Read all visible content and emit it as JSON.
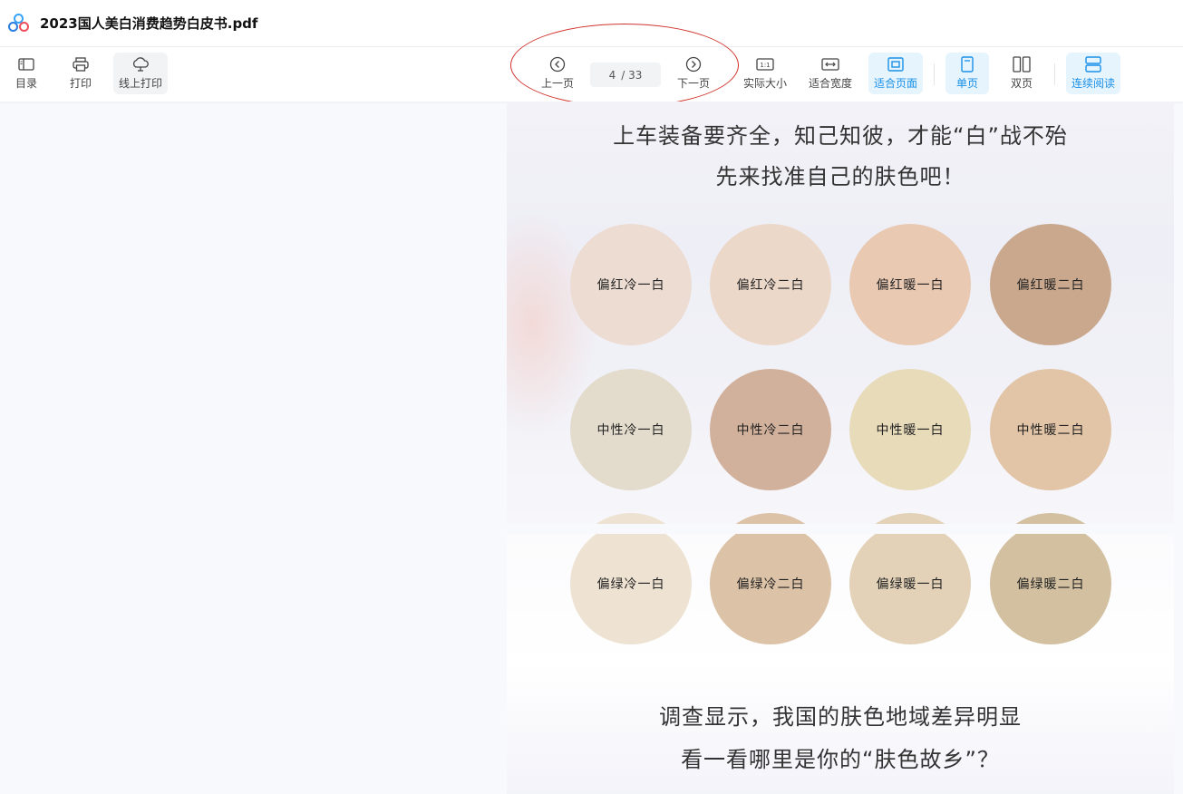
{
  "window": {
    "title": "2023国人美白消费趋势白皮书.pdf"
  },
  "toolbar": {
    "toc_label": "目录",
    "print_label": "打印",
    "online_print_label": "线上打印",
    "prev_label": "上一页",
    "next_label": "下一页",
    "current_page": "4",
    "total_pages": "/ 33",
    "actual_size_label": "实际大小",
    "fit_width_label": "适合宽度",
    "fit_page_label": "适合页面",
    "single_page_label": "单页",
    "double_page_label": "双页",
    "continuous_label": "连续阅读"
  },
  "colors": {
    "accent": "#1a90e8",
    "active_bg": "#e6f4fd",
    "annotation": "#d0342c"
  },
  "document": {
    "page1": {
      "line1": "上车装备要齐全，知己知彼，才能“白”战不殆",
      "line2": "先来找准自己的肤色吧！",
      "tones": [
        {
          "label": "偏红冷一白",
          "color": "#ecdcd2"
        },
        {
          "label": "偏红冷二白",
          "color": "#ecd8c9"
        },
        {
          "label": "偏红暖一白",
          "color": "#e9c9b2"
        },
        {
          "label": "偏红暖二白",
          "color": "#c9a88d"
        },
        {
          "label": "中性冷一白",
          "color": "#e3dccd"
        },
        {
          "label": "中性冷二白",
          "color": "#d2b19c"
        },
        {
          "label": "中性暖一白",
          "color": "#e8dbba"
        },
        {
          "label": "中性暖二白",
          "color": "#e2c4a6"
        }
      ]
    },
    "page2": {
      "tones": [
        {
          "label": "偏绿冷一白",
          "color": "#eee2d2"
        },
        {
          "label": "偏绿冷二白",
          "color": "#dcc2a6"
        },
        {
          "label": "偏绿暖一白",
          "color": "#e3d2b8"
        },
        {
          "label": "偏绿暖二白",
          "color": "#d2c0a0"
        }
      ],
      "line1": "调查显示，我国的肤色地域差异明显",
      "line2": "看一看哪里是你的“肤色故乡”？"
    }
  }
}
